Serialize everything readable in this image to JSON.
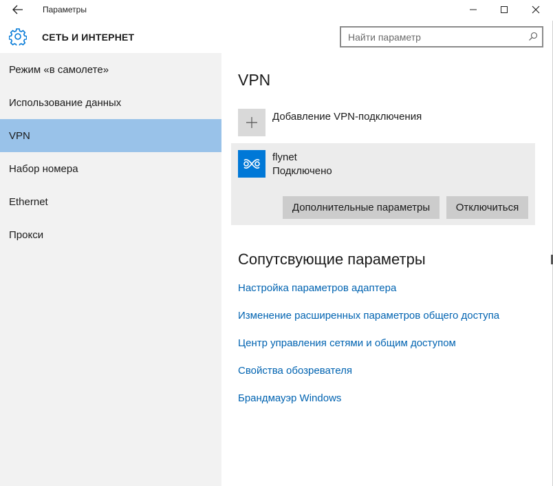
{
  "window": {
    "title": "Параметры"
  },
  "header": {
    "section_title": "СЕТЬ И ИНТЕРНЕТ",
    "search_placeholder": "Найти параметр"
  },
  "sidebar": {
    "items": [
      {
        "label": "Режим «в самолете»"
      },
      {
        "label": "Использование данных"
      },
      {
        "label": "VPN",
        "active": true
      },
      {
        "label": "Набор номера"
      },
      {
        "label": "Ethernet"
      },
      {
        "label": "Прокси"
      }
    ]
  },
  "main": {
    "title": "VPN",
    "add_label": "Добавление VPN-подключения",
    "connection": {
      "name": "flynet",
      "status": "Подключено",
      "advanced_button": "Дополнительные параметры",
      "disconnect_button": "Отключиться"
    },
    "related_title": "Сопутсвующие параметры",
    "links": [
      "Настройка параметров адаптера",
      "Изменение расширенных параметров общего доступа",
      "Центр управления сетями и общим доступом",
      "Свойства обозревателя",
      "Брандмауэр Windows"
    ]
  },
  "colors": {
    "accent": "#0078d7",
    "sidebar_active": "#99c2e9",
    "link": "#0063b1"
  },
  "icons": {
    "back": "back-arrow-icon",
    "settings": "gear-icon",
    "search": "search-icon",
    "add": "plus-icon",
    "vpn": "vpn-link-icon",
    "minimize": "minimize-icon",
    "maximize": "maximize-icon",
    "close": "close-icon"
  }
}
